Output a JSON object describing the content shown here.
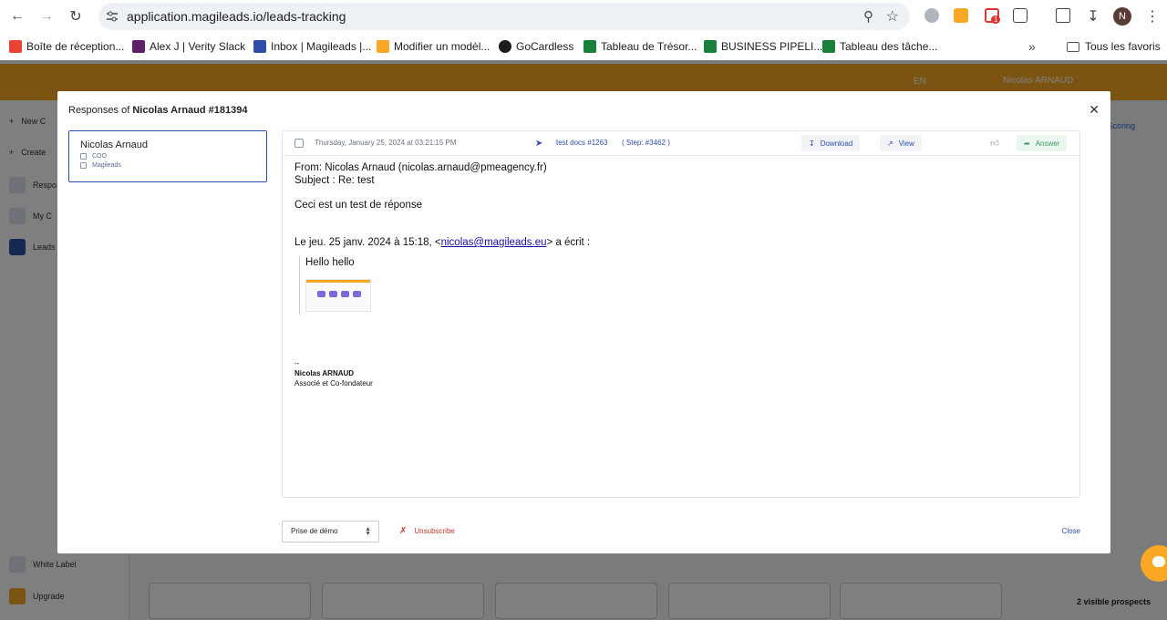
{
  "browser": {
    "url": "application.magileads.io/leads-tracking",
    "extension_badge": "1",
    "profile_initial": "N",
    "bookmarks": [
      {
        "label": "Boîte de réception...",
        "color": "#ea4335"
      },
      {
        "label": "Alex J | Verity Slack",
        "color": "#611f69"
      },
      {
        "label": "Inbox | Magileads |...",
        "color": "#2f4ea8"
      },
      {
        "label": "Modifier un modèl...",
        "color": "#f9a825"
      },
      {
        "label": "GoCardless",
        "color": "#1d1d1b"
      },
      {
        "label": "Tableau de Trésor...",
        "color": "#188038"
      },
      {
        "label": "BUSINESS PIPELI...",
        "color": "#188038"
      },
      {
        "label": "Tableau des tâche...",
        "color": "#188038"
      }
    ],
    "all_bookmarks_label": "Tous les favoris"
  },
  "app": {
    "user_name": "Nicolas ARNAUD",
    "language": "EN",
    "sidebar_items": [
      "New C",
      "Create",
      "Respo",
      "My C",
      "Leads",
      "White Label",
      "Upgrade"
    ],
    "lead_scoring_label": "i Scoring",
    "visible_prospects": "2 visible prospects"
  },
  "modal": {
    "title_prefix": "Responses of",
    "title_bold": "Nicolas Arnaud #181394",
    "contact": {
      "name": "Nicolas Arnaud",
      "role": "COO",
      "company": "Magileads"
    },
    "message": {
      "date": "Thursday, January 25, 2024 at 03:21:15 PM",
      "campaign": "test docs #1263",
      "step": "( Step: #3462 )",
      "download_label": "Download",
      "view_label": "View",
      "answer_label": "Answer",
      "from": "From: Nicolas Arnaud (nicolas.arnaud@pmeagency.fr)",
      "subject": "Subject : Re: test",
      "body": "Ceci est un test de réponse",
      "quote_intro_prefix": "Le jeu. 25 janv. 2024 à 15:18, <",
      "quote_email": "nicolas@magileads.eu",
      "quote_intro_suffix": "> a écrit :",
      "quote_text": "Hello hello",
      "sig_dashes": "--",
      "sig_name": "Nicolas ARNAUD",
      "sig_title": "Associé et Co-fondateur"
    },
    "status_select": "Prise de démo",
    "unsubscribe_label": "Unsubscribe",
    "close_label": "Close"
  }
}
